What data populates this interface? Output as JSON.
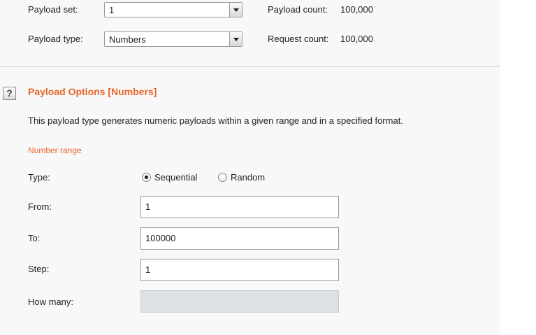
{
  "payload_set": {
    "label": "Payload set:",
    "value": "1",
    "count_label": "Payload count:",
    "count_value": "100,000"
  },
  "payload_type": {
    "label": "Payload type:",
    "value": "Numbers",
    "count_label": "Request count:",
    "count_value": "100,000"
  },
  "options": {
    "help_glyph": "?",
    "title": "Payload Options [Numbers]",
    "description": "This payload type generates numeric payloads within a given range and in a specified format.",
    "number_range_heading": "Number range",
    "type_label": "Type:",
    "type_options": [
      "Sequential",
      "Random"
    ],
    "type_selected": "Sequential",
    "from_label": "From:",
    "from_value": "1",
    "to_label": "To:",
    "to_value": "100000",
    "step_label": "Step:",
    "step_value": "1",
    "how_many_label": "How many:",
    "how_many_value": ""
  },
  "colors": {
    "accent": "#e8662b",
    "panel": "#f8f8f8",
    "disabled_field": "#dde1e4"
  }
}
